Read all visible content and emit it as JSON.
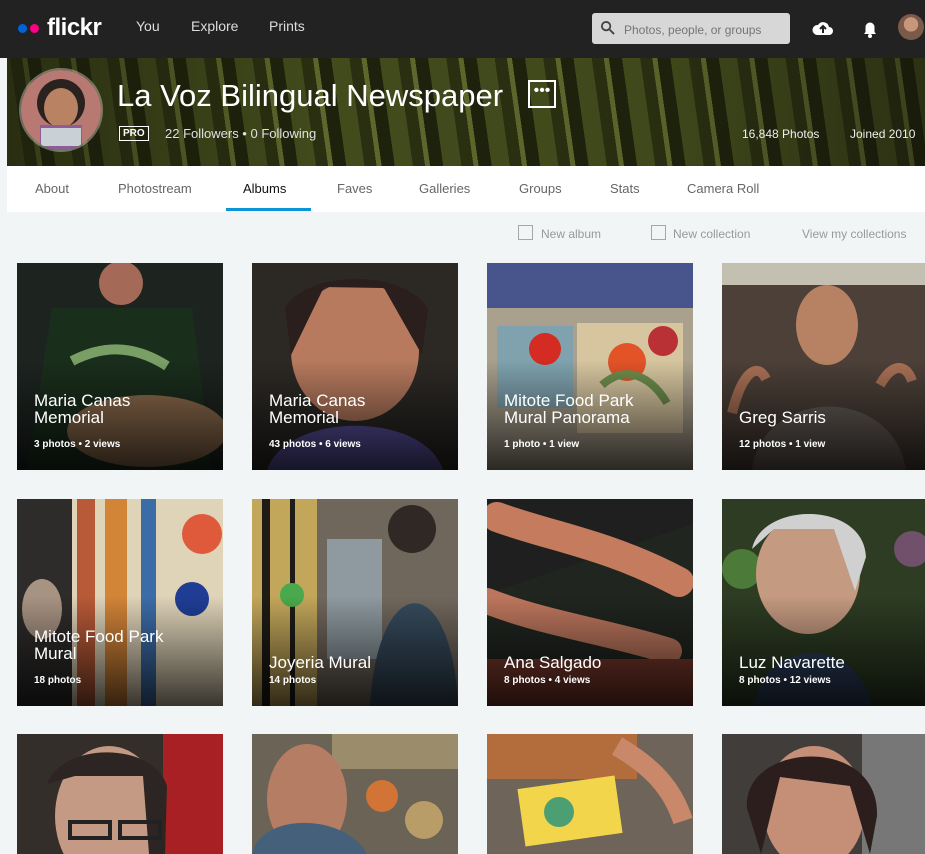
{
  "topbar": {
    "logo_text": "flickr",
    "nav": [
      "You",
      "Explore",
      "Prints"
    ],
    "search": {
      "placeholder": "Photos, people, or groups"
    }
  },
  "profile": {
    "name": "La Voz Bilingual Newspaper",
    "pro_badge": "PRO",
    "followers_following": "22 Followers  •  0 Following",
    "photos_count": "16,848 Photos",
    "joined": "Joined 2010"
  },
  "tabs": [
    "About",
    "Photostream",
    "Albums",
    "Faves",
    "Galleries",
    "Groups",
    "Stats",
    "Camera Roll"
  ],
  "actions": {
    "new_album": "New album",
    "new_collection": "New collection",
    "view_collections": "View my collections"
  },
  "albums": [
    {
      "title": "Maria Canas\nMemorial",
      "meta": "3 photos  •  2 views",
      "icon": "weaving-photo"
    },
    {
      "title": "Maria Canas\nMemorial",
      "meta": "43 photos  •  6 views",
      "icon": "portrait-photo"
    },
    {
      "title": "Mitote Food Park\nMural Panorama",
      "meta": "1 photo  •  1 view",
      "icon": "mural-photo"
    },
    {
      "title": "Greg Sarris",
      "meta": "12 photos  •  1 view",
      "icon": "speaker-photo"
    },
    {
      "title": "Mitote Food Park\nMural",
      "meta": "18 photos",
      "icon": "mural-painting-photo"
    },
    {
      "title": "Joyeria Mural",
      "meta": "14 photos",
      "icon": "painting-photo"
    },
    {
      "title": "Ana Salgado",
      "meta": "8 photos  •  4 views",
      "icon": "hands-photo"
    },
    {
      "title": "Luz Navarette",
      "meta": "8 photos  •  12 views",
      "icon": "smile-portrait-photo"
    }
  ],
  "colors": {
    "topbar": "#222222",
    "blue_dot": "#0063dc",
    "pink_dot": "#ff0084",
    "active_tab": "#0a96d6"
  }
}
